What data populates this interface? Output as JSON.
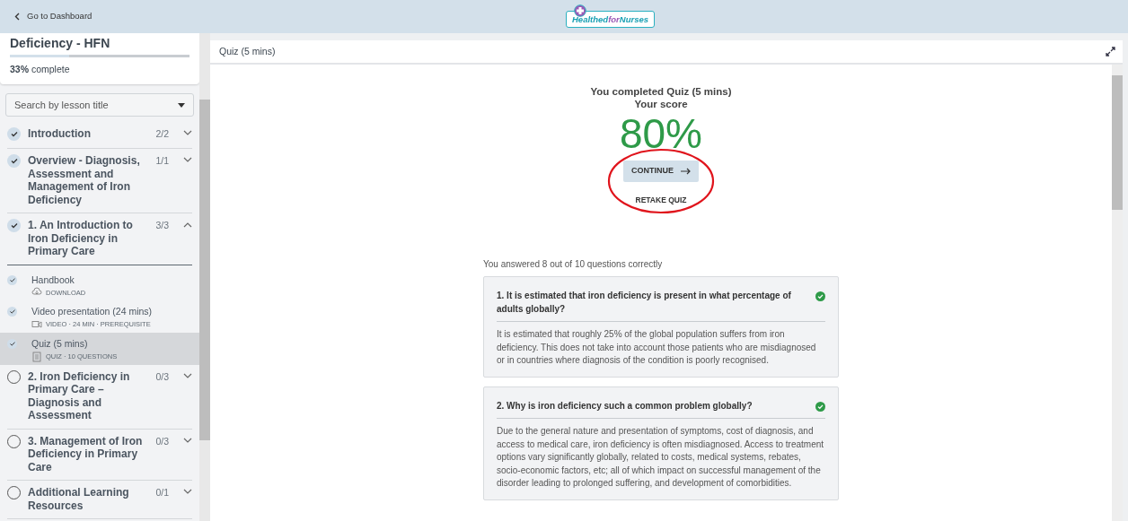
{
  "header": {
    "back_link": "Go to Dashboard",
    "logo": {
      "word_1": "Healthed",
      "word_2": "for",
      "word_3": "Nurses"
    }
  },
  "course": {
    "title": "Deficiency - HFN",
    "progress": {
      "level": 0.33,
      "percent": "33%",
      "label": "complete"
    }
  },
  "search": {
    "placeholder": "Search by lesson title"
  },
  "lessons": [
    {
      "title": "Introduction",
      "count": "2/2",
      "completed": true,
      "expanded": false
    },
    {
      "title": "Overview - Diagnosis, Assessment and Management of Iron Deficiency",
      "count": "1/1",
      "completed": true,
      "expanded": false
    },
    {
      "title": "1. An Introduction to Iron Deficiency in Primary Care",
      "count": "3/3",
      "completed": true,
      "expanded": true,
      "children": [
        {
          "title": "Handbook",
          "meta": "DOWNLOAD",
          "kind": "download",
          "completed": true,
          "selected": false
        },
        {
          "title": "Video presentation (24 mins)",
          "meta": "VIDEO · 24 MIN · PREREQUISITE",
          "kind": "video",
          "completed": true,
          "selected": false
        },
        {
          "title": "Quiz (5 mins)",
          "meta": "QUIZ · 10 QUESTIONS",
          "kind": "quiz",
          "completed": true,
          "selected": true
        }
      ]
    },
    {
      "title": "2. Iron Deficiency in Primary Care – Diagnosis and Assessment",
      "count": "0/3",
      "completed": false,
      "expanded": false
    },
    {
      "title": "3. Management of Iron Deficiency in Primary Care",
      "count": "0/3",
      "completed": false,
      "expanded": false
    },
    {
      "title": "Additional Learning Resources",
      "count": "0/1",
      "completed": false,
      "expanded": false
    }
  ],
  "panel": {
    "title": "Quiz (5 mins)"
  },
  "result": {
    "completed_line": "You completed Quiz (5 mins)",
    "score_label": "Your score",
    "score": "80%",
    "continue_button": "CONTINUE",
    "retake_button": "RETAKE QUIZ",
    "summary": "You answered 8 out of 10 questions correctly"
  },
  "questions": [
    {
      "question": "1. It is estimated that iron deficiency is present in what percentage of adults globally?",
      "correct": true,
      "explanation": "It is estimated that roughly 25% of the global population suffers from iron deficiency. This does not take into account those patients who are misdiagnosed or in countries where diagnosis of the condition is poorly recognised."
    },
    {
      "question": "2. Why is iron deficiency such a common problem globally?",
      "correct": true,
      "explanation": "Due to the general nature and presentation of symptoms, cost of diagnosis, and access to medical care, iron deficiency is often misdiagnosed. Access to treatment options vary significantly globally, related to costs, medical systems, rebates, socio-economic factors, etc; all of which impact on successful management of the disorder leading to prolonged suffering, and development of comorbidities."
    }
  ]
}
